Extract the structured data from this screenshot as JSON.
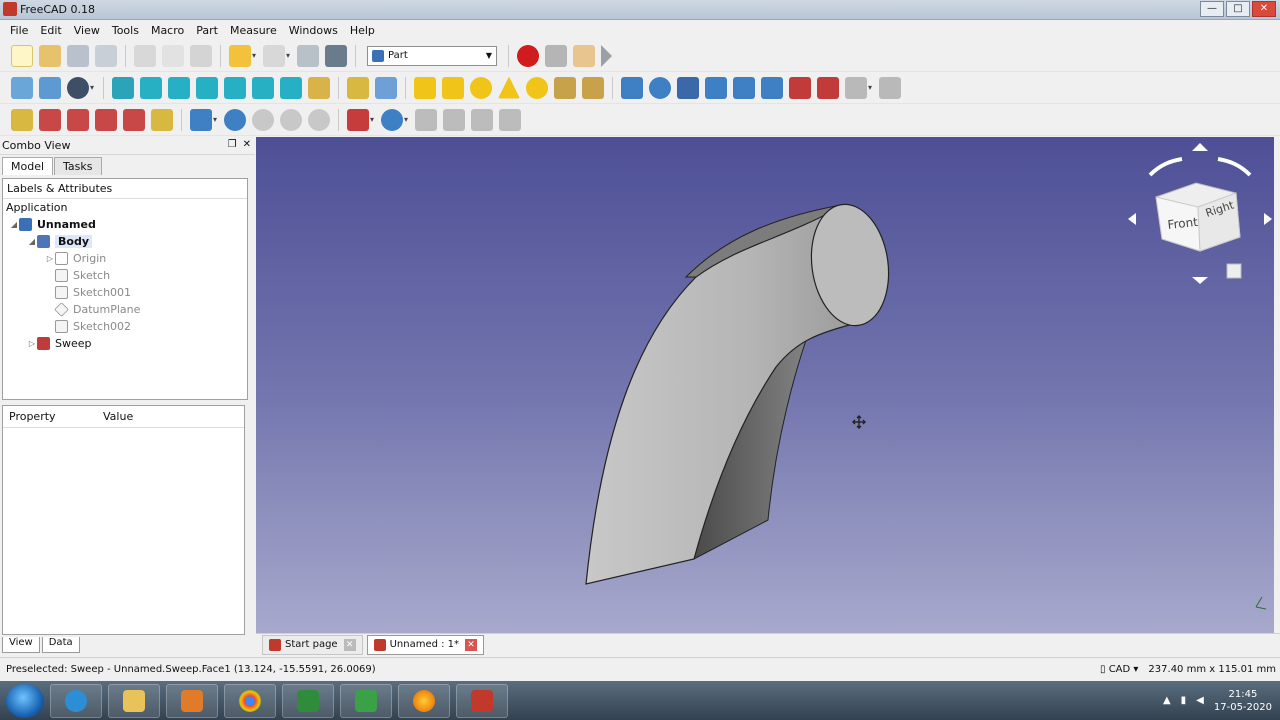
{
  "window": {
    "title": "FreeCAD 0.18",
    "minimize": "—",
    "maximize": "□",
    "close": "✕"
  },
  "menu": [
    "File",
    "Edit",
    "View",
    "Tools",
    "Macro",
    "Part",
    "Measure",
    "Windows",
    "Help"
  ],
  "workbench": {
    "selected": "Part"
  },
  "combo_view": {
    "title": "Combo View",
    "tabs": [
      "Model",
      "Tasks"
    ],
    "tree_header": "Labels & Attributes",
    "application": "Application",
    "items": [
      {
        "label": "Unnamed"
      },
      {
        "label": "Body"
      },
      {
        "label": "Origin"
      },
      {
        "label": "Sketch"
      },
      {
        "label": "Sketch001"
      },
      {
        "label": "DatumPlane"
      },
      {
        "label": "Sketch002"
      },
      {
        "label": "Sweep"
      }
    ],
    "property_columns": [
      "Property",
      "Value"
    ],
    "bottom_tabs": [
      "View",
      "Data"
    ]
  },
  "navcube": {
    "front": "Front",
    "right": "Right"
  },
  "view_tabs": [
    {
      "label": "Start page"
    },
    {
      "label": "Unnamed : 1*"
    }
  ],
  "status": {
    "message": "Preselected: Sweep - Unnamed.Sweep.Face1 (13.124, -15.5591, 26.0069)",
    "nav_style": "CAD",
    "dimensions": "237.40 mm x 115.01 mm"
  },
  "taskbar": {
    "time": "21:45",
    "date": "17-05-2020"
  },
  "colors": {
    "viewport_top": "#4e4f96",
    "viewport_bottom": "#a8a9cc",
    "accent": "#c0392b"
  }
}
